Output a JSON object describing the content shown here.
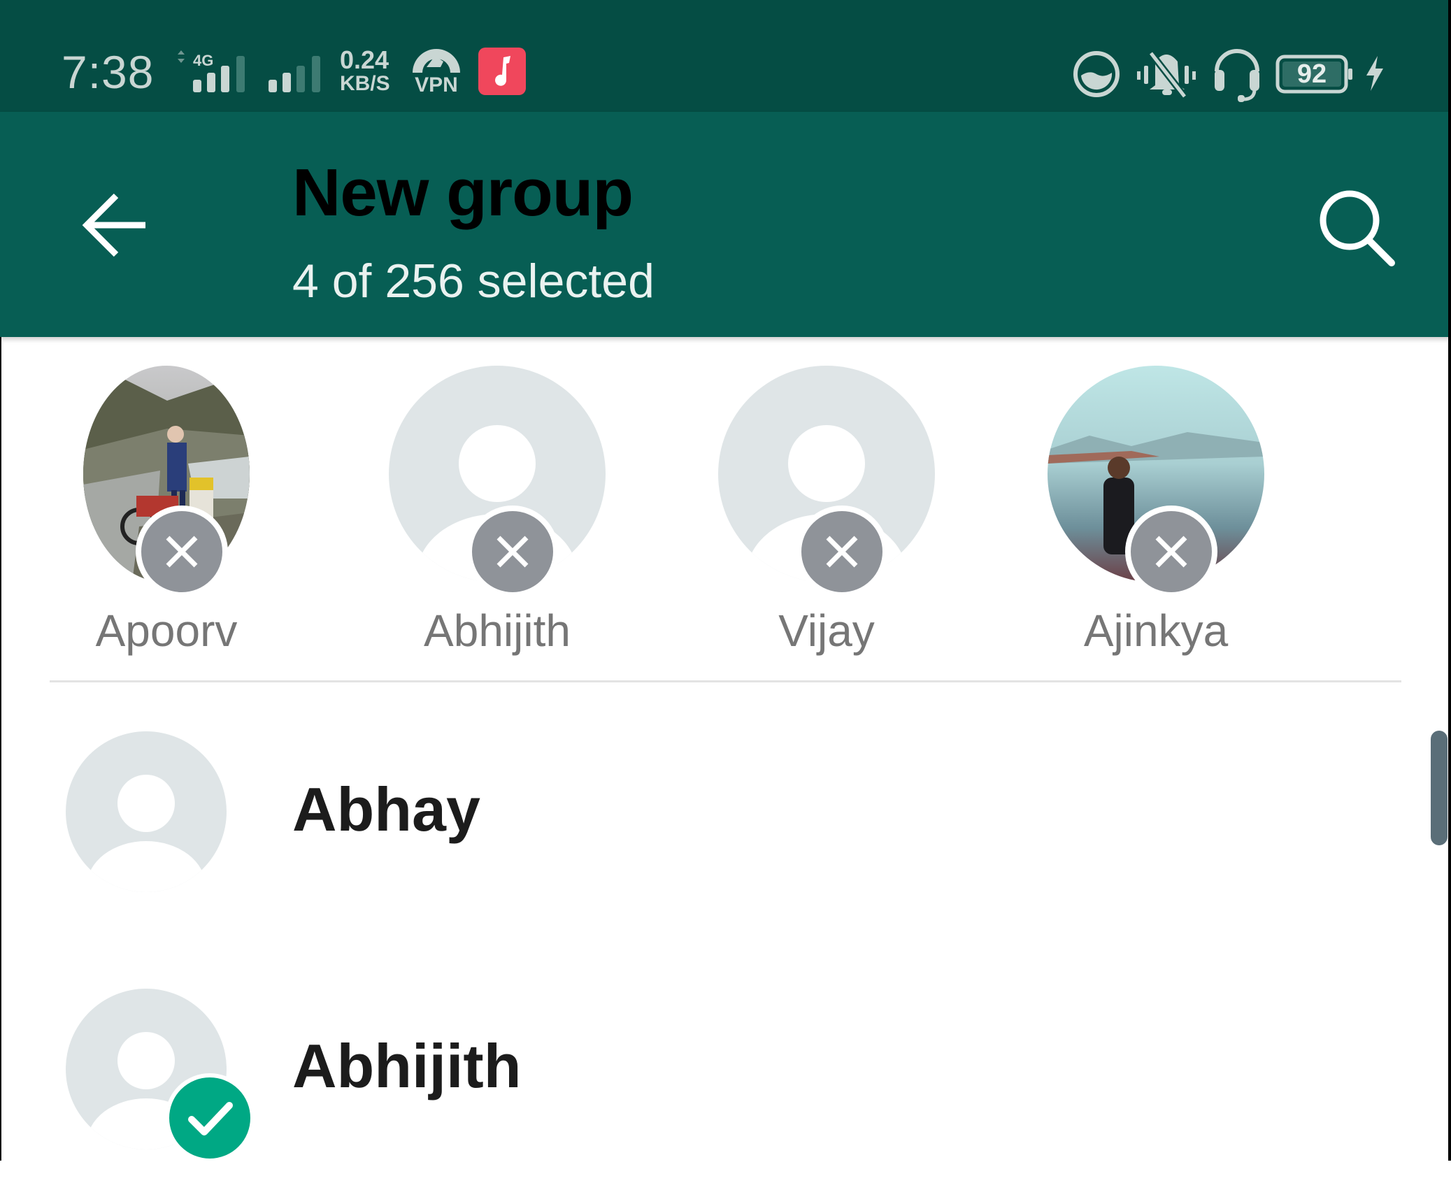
{
  "status_bar": {
    "time": "7:38",
    "network_type": "4G",
    "data_speed_value": "0.24",
    "data_speed_unit": "KB/S",
    "vpn_label": "VPN",
    "battery_percent": "92",
    "icons": [
      "signal-sim1-icon",
      "signal-sim2-icon",
      "vpn-icon",
      "music-app-icon",
      "data-saver-icon",
      "vibrate-silent-icon",
      "headset-icon",
      "battery-icon",
      "charging-icon"
    ],
    "music_app_color": "#f0475c"
  },
  "header": {
    "title": "New group",
    "subtitle": "4 of 256 selected",
    "back_icon": "arrow-left-icon",
    "search_icon": "search-icon",
    "background_color": "#075e54"
  },
  "selected_contacts": [
    {
      "name": "Apoorv",
      "avatar": "photo-mountain-road"
    },
    {
      "name": "Abhijith",
      "avatar": "default-avatar"
    },
    {
      "name": "Vijay",
      "avatar": "default-avatar"
    },
    {
      "name": "Ajinkya",
      "avatar": "photo-lake"
    }
  ],
  "contacts": [
    {
      "name": "Abhay",
      "selected": false
    },
    {
      "name": "Abhijith",
      "selected": true
    }
  ],
  "colors": {
    "accent": "#00a884",
    "remove_badge": "#8f9399",
    "placeholder_avatar": "#dfe5e7"
  }
}
